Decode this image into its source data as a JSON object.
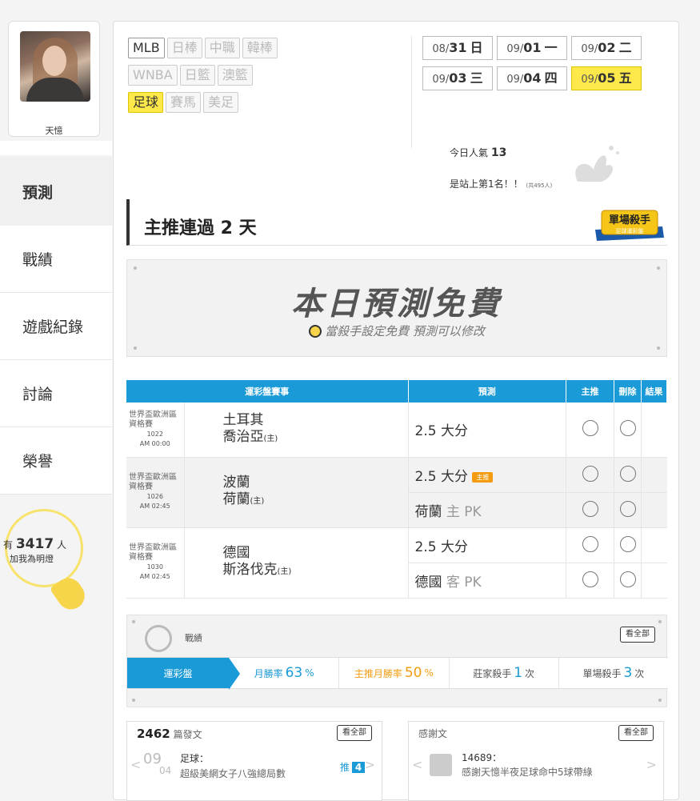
{
  "profile": {
    "name": "天憶"
  },
  "nav": {
    "items": [
      "預測",
      "戰績",
      "遊戲紀錄",
      "討論",
      "榮譽"
    ],
    "active": "預測"
  },
  "fans": {
    "prefix": "有",
    "count": "3417",
    "suffix": "人",
    "line2": "加我為明燈"
  },
  "sports": {
    "chips": [
      {
        "label": "MLB",
        "state": "on"
      },
      {
        "label": "日棒",
        "state": "off"
      },
      {
        "label": "中職",
        "state": "off"
      },
      {
        "label": "韓棒",
        "state": "off"
      },
      {
        "label": "WNBA",
        "state": "off"
      },
      {
        "label": "日籃",
        "state": "off"
      },
      {
        "label": "澳籃",
        "state": "off"
      },
      {
        "label": "足球",
        "state": "selected"
      },
      {
        "label": "賽馬",
        "state": "off"
      },
      {
        "label": "美足",
        "state": "off"
      }
    ]
  },
  "dates": [
    {
      "md": "08/",
      "day": "31",
      "wd": "日",
      "selected": false
    },
    {
      "md": "09/",
      "day": "01",
      "wd": "一",
      "selected": false
    },
    {
      "md": "09/",
      "day": "02",
      "wd": "二",
      "selected": false
    },
    {
      "md": "09/",
      "day": "03",
      "wd": "三",
      "selected": false
    },
    {
      "md": "09/",
      "day": "04",
      "wd": "四",
      "selected": false
    },
    {
      "md": "09/",
      "day": "05",
      "wd": "五",
      "selected": true
    }
  ],
  "popularity": {
    "label": "今日人氣",
    "value": "13",
    "rank": "是站上第1名！！",
    "total": "(共495人)"
  },
  "streak": {
    "title": "主推連過 2 天",
    "badge_line1": "單場殺手",
    "badge_line2": "足球運彩盤"
  },
  "free": {
    "title": "本日預測免費",
    "subtitle": "當殺手設定免費 預測可以修改"
  },
  "table": {
    "headers": [
      "運彩盤賽事",
      "預測",
      "主推",
      "刪除",
      "結果"
    ],
    "main_badge": "主推",
    "games": [
      {
        "league": "世界盃歐洲區資格賽",
        "time1": "1022",
        "time2": "AM 00:00",
        "team1": "土耳其",
        "team2": "喬治亞",
        "host": "(主)",
        "picks": [
          {
            "main": "2.5 大分",
            "grey": "",
            "badge": false
          }
        ]
      },
      {
        "league": "世界盃歐洲區資格賽",
        "time1": "1026",
        "time2": "AM 02:45",
        "team1": "波蘭",
        "team2": "荷蘭",
        "host": "(主)",
        "picks": [
          {
            "main": "2.5 大分",
            "grey": "",
            "badge": true
          },
          {
            "main": "荷蘭",
            "grey": " 主 PK",
            "badge": false
          }
        ]
      },
      {
        "league": "世界盃歐洲區資格賽",
        "time1": "1030",
        "time2": "AM 02:45",
        "team1": "德國",
        "team2": "斯洛伐克",
        "host": "(主)",
        "picks": [
          {
            "main": "2.5 大分",
            "grey": "",
            "badge": false
          },
          {
            "main": "德國",
            "grey": " 客 PK",
            "badge": false
          }
        ]
      }
    ]
  },
  "record": {
    "title": "戰績",
    "view_all": "看全部",
    "tabs": {
      "market": "運彩盤",
      "monthly_label": "月勝率",
      "monthly_value": "63",
      "monthly_unit": "%",
      "main_label": "主推月勝率",
      "main_value": "50",
      "main_unit": "%",
      "house_label": "莊家殺手",
      "house_value": "1",
      "house_unit": "次",
      "single_label": "單場殺手",
      "single_value": "3",
      "single_unit": "次"
    }
  },
  "posts": {
    "count": "2462",
    "label": "篇發文",
    "view_all": "看全部",
    "month": "09",
    "day": "04",
    "category": "足球：",
    "title": "超級美網女子八強總局數",
    "push_label": "推",
    "push_count": "4"
  },
  "thanks": {
    "label": "感謝文",
    "view_all": "看全部",
    "id": "14689：",
    "text": "感謝天憶半夜足球命中5球帶綠"
  }
}
